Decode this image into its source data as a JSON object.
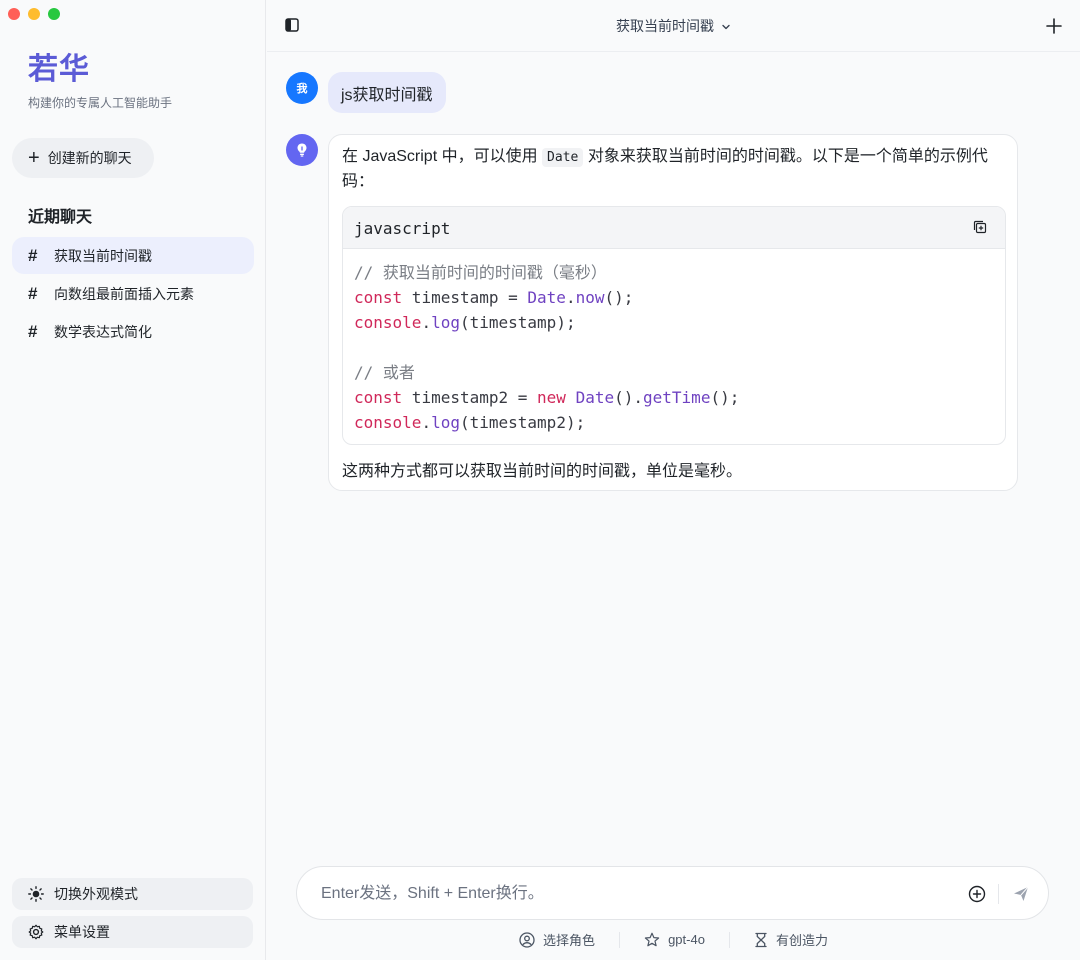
{
  "sidebar": {
    "brand_title": "若华",
    "brand_subtitle": "构建你的专属人工智能助手",
    "new_chat_label": "创建新的聊天",
    "recent_title": "近期聊天",
    "items": [
      {
        "label": "获取当前时间戳",
        "active": true
      },
      {
        "label": "向数组最前面插入元素",
        "active": false
      },
      {
        "label": "数学表达式简化",
        "active": false
      }
    ],
    "toggle_theme_label": "切换外观模式",
    "settings_label": "菜单设置"
  },
  "header": {
    "title": "获取当前时间戳",
    "chevron": "⌄"
  },
  "conversation": {
    "user_avatar": "我",
    "user_message": "js获取时间戳",
    "bot_intro_1": "在 JavaScript 中，可以使用",
    "bot_inline_code": "Date",
    "bot_intro_2": "对象来获取当前时间的时间戳。以下是一个简单的示例代码：",
    "code_lang": "javascript",
    "code": {
      "comment1": "// 获取当前时间的时间戳（毫秒）",
      "kw_const": "const",
      "var1": " timestamp = ",
      "date": "Date",
      "dot": ".",
      "now": "now",
      "call_end": "();",
      "console": "console",
      "log": "log",
      "arg1": "(timestamp);",
      "comment2": "// 或者",
      "var2": " timestamp2 = ",
      "kw_new": "new",
      "space": " ",
      "paren_dot": "().",
      "getTime": "getTime",
      "arg2": "(timestamp2);"
    },
    "bot_outro": "这两种方式都可以获取当前时间的时间戳，单位是毫秒。"
  },
  "input": {
    "placeholder": "Enter发送，Shift + Enter换行。"
  },
  "tools": {
    "role_label": "选择角色",
    "model_label": "gpt-4o",
    "creativity_label": "有创造力"
  },
  "colors": {
    "accent": "#5b5bd6",
    "user_avatar": "#1677ff",
    "bot_avatar": "#6366f1",
    "keyword": "#d0285a",
    "function": "#6f42c1"
  }
}
